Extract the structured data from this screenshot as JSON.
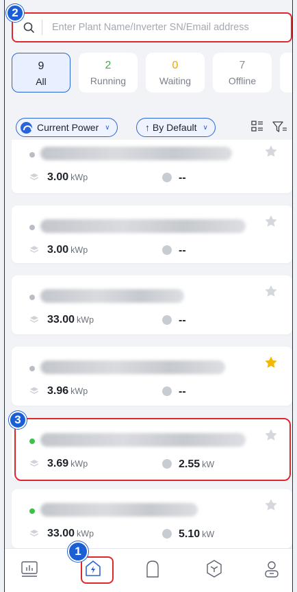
{
  "search": {
    "placeholder": "Enter Plant Name/Inverter SN/Email address"
  },
  "tabs": [
    {
      "count": "9",
      "label": "All",
      "active": true,
      "color": "#1d2129"
    },
    {
      "count": "2",
      "label": "Running",
      "active": false,
      "color": "#3cb043"
    },
    {
      "count": "0",
      "label": "Waiting",
      "active": false,
      "color": "#f0a500"
    },
    {
      "count": "7",
      "label": "Offline",
      "active": false,
      "color": "#8a8f98"
    }
  ],
  "filters": {
    "sort_field": "Current Power",
    "sort_order": "↑ By Default"
  },
  "plants": [
    {
      "capacity": "3.00",
      "capacity_unit": "kWp",
      "power": "--",
      "power_unit": "",
      "online": false,
      "favorite": false
    },
    {
      "capacity": "3.00",
      "capacity_unit": "kWp",
      "power": "--",
      "power_unit": "",
      "online": false,
      "favorite": false
    },
    {
      "capacity": "33.00",
      "capacity_unit": "kWp",
      "power": "--",
      "power_unit": "",
      "online": false,
      "favorite": false
    },
    {
      "capacity": "3.96",
      "capacity_unit": "kWp",
      "power": "--",
      "power_unit": "",
      "online": false,
      "favorite": true
    },
    {
      "capacity": "3.69",
      "capacity_unit": "kWp",
      "power": "2.55",
      "power_unit": "kW",
      "online": true,
      "favorite": false
    },
    {
      "capacity": "33.00",
      "capacity_unit": "kWp",
      "power": "5.10",
      "power_unit": "kW",
      "online": true,
      "favorite": false
    }
  ],
  "annotations": {
    "badge_1": "1",
    "badge_2": "2",
    "badge_3": "3"
  },
  "colors": {
    "accent": "#2b63d9",
    "highlight": "#e0262d",
    "badge": "#1b5fd6",
    "favorite_star": "#f5b800"
  },
  "icons": {
    "nav": [
      "chart-icon",
      "plant-home-icon",
      "device-icon",
      "cube-icon",
      "profile-icon"
    ]
  }
}
